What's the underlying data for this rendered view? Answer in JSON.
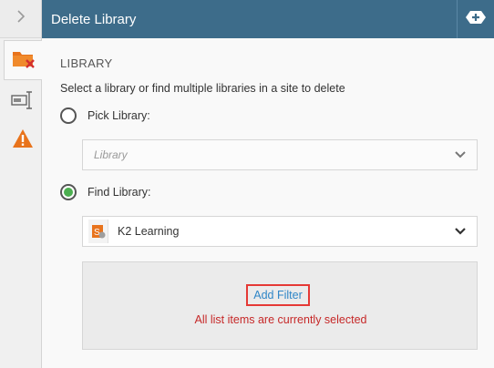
{
  "header": {
    "title": "Delete Library",
    "action_icon": "add-icon"
  },
  "rail": {
    "toggle_icon": "chevron-right-icon",
    "tabs": [
      {
        "name": "delete-library-tab",
        "icon": "folder-delete-icon",
        "active": true
      },
      {
        "name": "input-mapping-tab",
        "icon": "input-field-icon",
        "active": false
      },
      {
        "name": "errors-tab",
        "icon": "warning-icon",
        "active": false
      }
    ]
  },
  "section": {
    "title": "LIBRARY",
    "description": "Select a library or find multiple libraries in a site to delete"
  },
  "options": {
    "pick": {
      "label": "Pick Library:",
      "checked": false,
      "placeholder": "Library"
    },
    "find": {
      "label": "Find Library:",
      "checked": true,
      "site_value": "K2 Learning"
    }
  },
  "filter": {
    "add_label": "Add Filter",
    "status": "All list items are currently selected"
  },
  "colors": {
    "header_bg": "#3d6c8a",
    "accent_green": "#4caf50",
    "link_blue": "#2f86c7",
    "alert_red": "#c62828",
    "highlight_border": "#e53935",
    "icon_orange": "#e8731c"
  }
}
